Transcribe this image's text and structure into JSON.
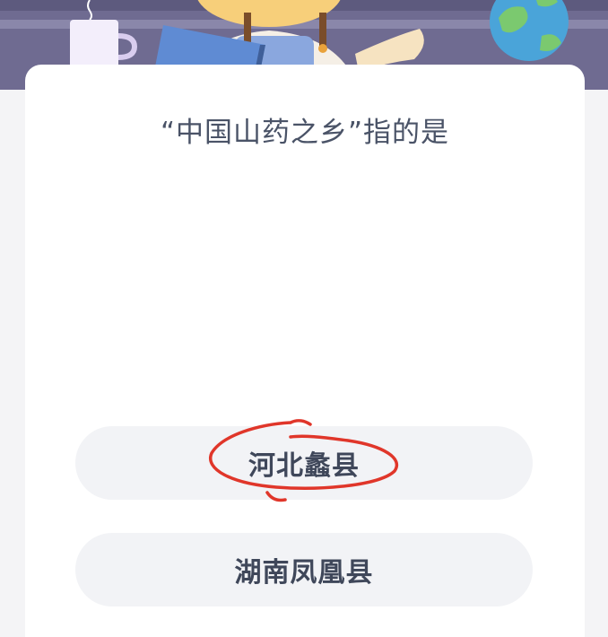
{
  "quiz": {
    "question": "“中国山药之乡”指的是",
    "options": [
      {
        "label": "河北蠡县",
        "circled": true
      },
      {
        "label": "湖南凤凰县",
        "circled": false
      }
    ]
  },
  "colors": {
    "banner_bg": "#6f6b91",
    "card_bg": "#ffffff",
    "option_bg": "#f2f3f6",
    "annotation_red": "#e0362a",
    "text_dark": "#3f475a"
  },
  "icons": [
    "mug-icon",
    "character-illustration",
    "book-icon",
    "globe-icon",
    "hand-drawn-circle"
  ]
}
